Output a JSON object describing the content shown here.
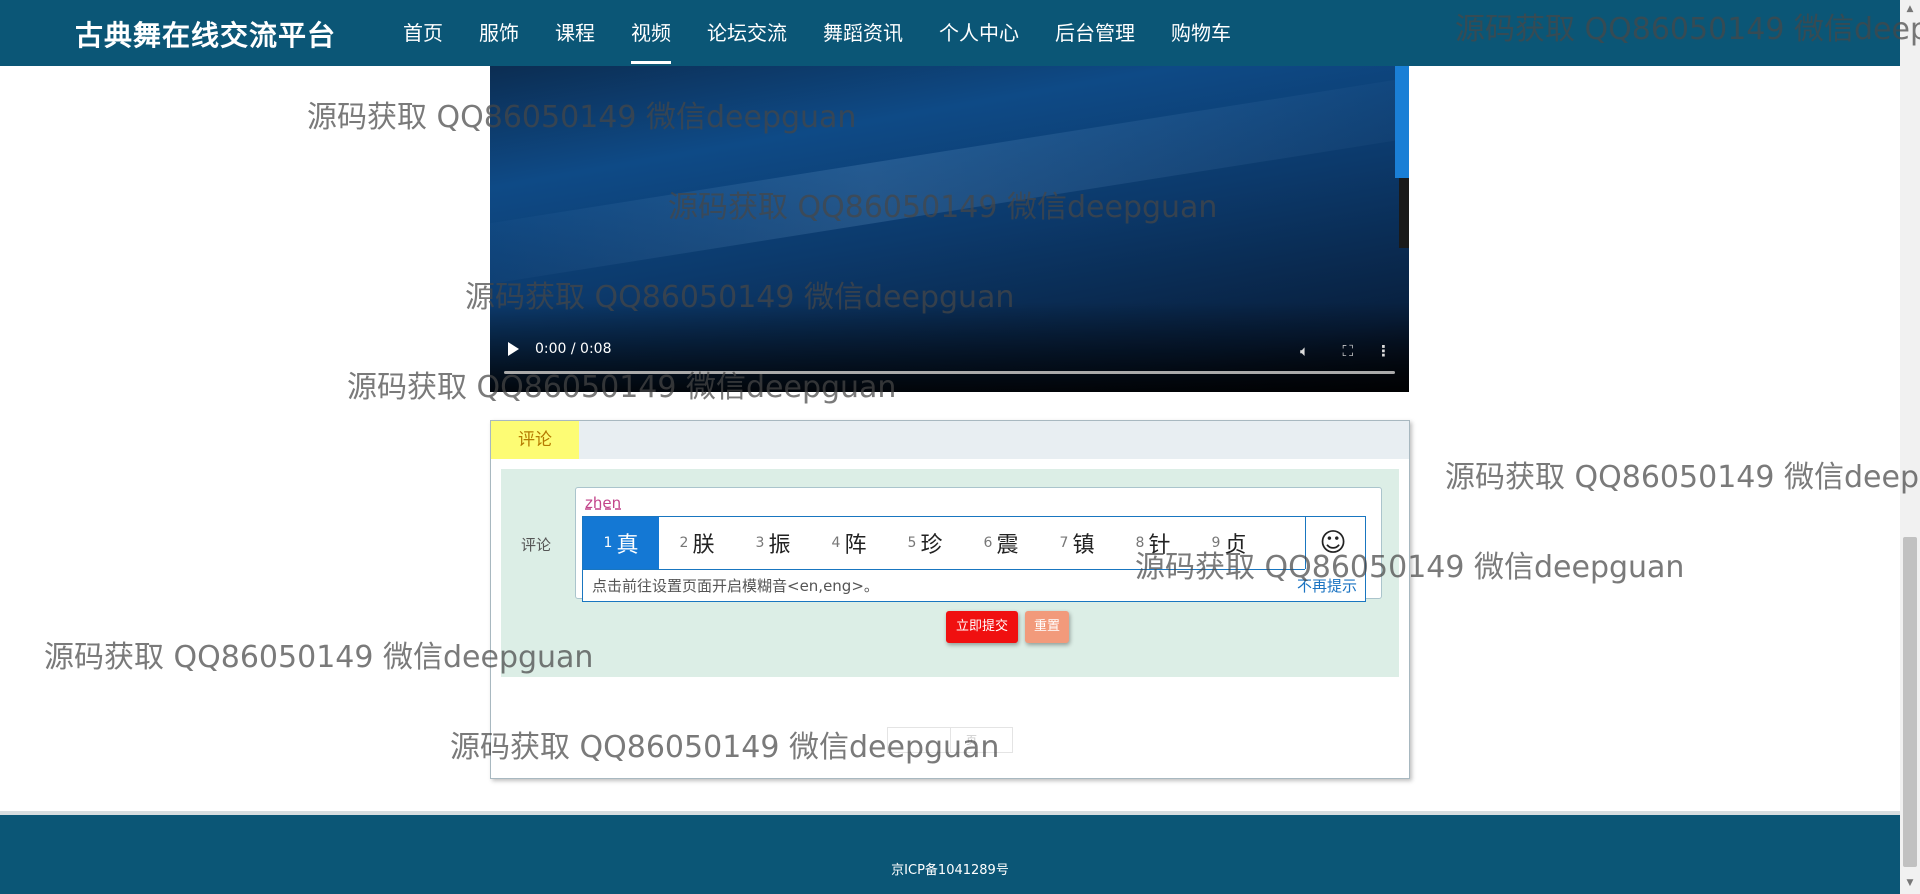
{
  "header": {
    "brand": "古典舞在线交流平台",
    "nav": [
      {
        "label": "首页"
      },
      {
        "label": "服饰"
      },
      {
        "label": "课程"
      },
      {
        "label": "视频",
        "active": true
      },
      {
        "label": "论坛交流"
      },
      {
        "label": "舞蹈资讯"
      },
      {
        "label": "个人中心"
      },
      {
        "label": "后台管理"
      },
      {
        "label": "购物车"
      }
    ]
  },
  "video": {
    "time": "0:00 / 0:08",
    "progress": 0
  },
  "comment": {
    "tab_label": "评论",
    "field_label": "评论",
    "typed_text": "zhen",
    "ime": {
      "candidates": [
        {
          "num": "1",
          "char": "真"
        },
        {
          "num": "2",
          "char": "朕"
        },
        {
          "num": "3",
          "char": "振"
        },
        {
          "num": "4",
          "char": "阵"
        },
        {
          "num": "5",
          "char": "珍"
        },
        {
          "num": "6",
          "char": "震"
        },
        {
          "num": "7",
          "char": "镇"
        },
        {
          "num": "8",
          "char": "针"
        },
        {
          "num": "9",
          "char": "贞"
        }
      ],
      "emoji_symbol": "☺",
      "hint": "点击前往设置页面开启模糊音<en,eng>。",
      "dismiss_label": "不再提示"
    },
    "submit_label": "立即提交",
    "reset_label": "重置",
    "pager_label": "页"
  },
  "footer": {
    "icp": "京ICP备1041289号"
  },
  "watermark": "源码获取 QQ86050149 微信deepguan",
  "colors": {
    "header_bg": "#0b5676",
    "tab_bg": "#fdfc74",
    "form_bg": "#dceee6",
    "submit_bg": "#f01010",
    "reset_bg": "#f29a7b",
    "ime_selected": "#1478d4"
  }
}
